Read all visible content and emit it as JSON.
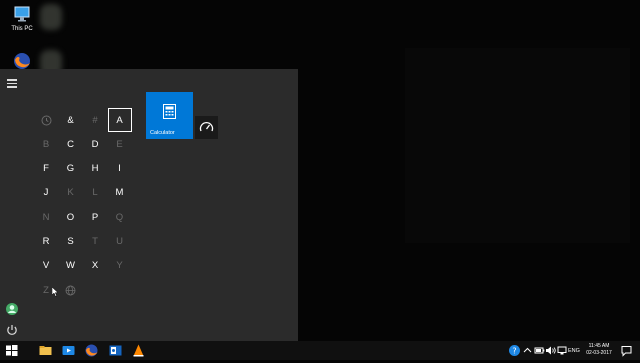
{
  "desktop": {
    "icons": [
      {
        "label": "This PC",
        "icon": "monitor-icon"
      },
      {
        "label": "",
        "icon": "firefox-icon"
      }
    ]
  },
  "start_menu": {
    "letter_grid": [
      [
        "clock-icon",
        "&",
        "#",
        "A"
      ],
      [
        "B",
        "C",
        "D",
        "E"
      ],
      [
        "F",
        "G",
        "H",
        "I"
      ],
      [
        "J",
        "K",
        "L",
        "M"
      ],
      [
        "N",
        "O",
        "P",
        "Q"
      ],
      [
        "R",
        "S",
        "T",
        "U"
      ],
      [
        "V",
        "W",
        "X",
        "Y"
      ],
      [
        "Z",
        "globe-icon",
        "",
        ""
      ]
    ],
    "enabled_letters": [
      "&",
      "A",
      "C",
      "D",
      "F",
      "G",
      "H",
      "I",
      "J",
      "M",
      "O",
      "P",
      "R",
      "S",
      "V",
      "W",
      "X"
    ],
    "selected_letter": "A",
    "tiles": {
      "calculator_label": "Calculator",
      "calculator_color": "#0078d7"
    }
  },
  "taskbar": {
    "items": [
      "windows-start-icon",
      "file-explorer-icon",
      "video-app-icon",
      "firefox-icon",
      "outlook-icon",
      "vlc-icon",
      "vlc-icon"
    ],
    "tray": {
      "language": "ENG",
      "time": "11:45 AM",
      "date": "02-03-2017"
    }
  }
}
